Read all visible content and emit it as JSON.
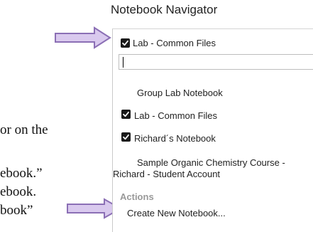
{
  "navigator": {
    "title": "Notebook Navigator",
    "current_selection": "Lab - Common Files",
    "search": {
      "value": "",
      "placeholder": ""
    },
    "items": [
      {
        "label": "Group Lab Notebook",
        "checked": false
      },
      {
        "label": "Lab - Common Files",
        "checked": true
      },
      {
        "label": "Richard´s Notebook",
        "checked": true
      },
      {
        "label_line1": "Sample Organic Chemistry Course -",
        "label_line2": "Richard - Student Account",
        "checked": false
      }
    ],
    "actions_heading": "Actions",
    "actions": [
      {
        "label": "Create New Notebook..."
      }
    ]
  },
  "background_text": {
    "line1": "or on the",
    "line2": "ebook.”",
    "line3": "ebook.",
    "line4": "book”"
  },
  "colors": {
    "arrow_fill": "#d9c9ee",
    "arrow_stroke": "#8b6fb5",
    "checkbox": "#1a1a1a",
    "actions_heading": "#999999"
  },
  "icons": {
    "search": "search-icon",
    "dropdown": "chevron-up-icon",
    "checkbox": "checkbox-checked-icon"
  }
}
